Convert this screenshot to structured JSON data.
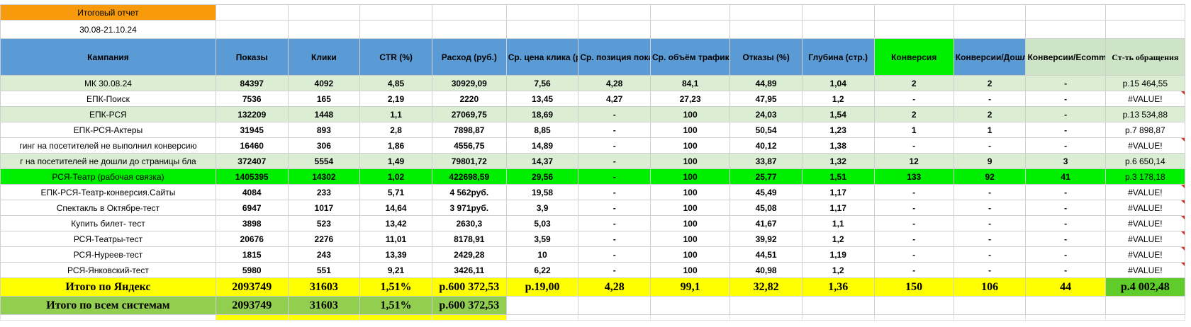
{
  "report_title": "Итоговый отчет",
  "period": "30.08-21.10.24",
  "headers": {
    "campaign": "Кампания",
    "impressions": "Показы",
    "clicks": "Клики",
    "ctr": "CTR (%)",
    "spend": "Расход (руб.)",
    "avg_cpc": "Ср. цена клика (руб.)",
    "avg_position": "Ср. позиция показов",
    "avg_traffic": "Ср. объём трафика",
    "bounce": "Отказы (%)",
    "depth": "Глубина (стр.)",
    "conversion": "Конверсия",
    "conv_thanks": "Конверсии/Дошли до страницы благодарности",
    "conv_ecom": "Конверсии/Ecommerce: покупка",
    "cost_per_conv": "Ст-ть обращения"
  },
  "rows": [
    {
      "campaign": "МК 30.08.24",
      "impressions": "84397",
      "clicks": "4092",
      "ctr": "4,85",
      "spend": "30929,09",
      "cpc": "7,56",
      "position": "4,28",
      "traffic": "84,1",
      "bounce": "44,89",
      "depth": "1,04",
      "conversion": "2",
      "conv_thanks": "2",
      "conv_ecom": "-",
      "cost": "р.15 464,55",
      "style": "light",
      "error": false
    },
    {
      "campaign": "ЕПК-Поиск",
      "impressions": "7536",
      "clicks": "165",
      "ctr": "2,19",
      "spend": "2220",
      "cpc": "13,45",
      "position": "4,27",
      "traffic": "27,23",
      "bounce": "47,95",
      "depth": "1,2",
      "conversion": "-",
      "conv_thanks": "-",
      "conv_ecom": "-",
      "cost": "#VALUE!",
      "style": "plain",
      "error": true
    },
    {
      "campaign": "ЕПК-РСЯ",
      "impressions": "132209",
      "clicks": "1448",
      "ctr": "1,1",
      "spend": "27069,75",
      "cpc": "18,69",
      "position": "-",
      "traffic": "100",
      "bounce": "24,03",
      "depth": "1,54",
      "conversion": "2",
      "conv_thanks": "2",
      "conv_ecom": "-",
      "cost": "р.13 534,88",
      "style": "light",
      "error": false
    },
    {
      "campaign": "ЕПК-РСЯ-Актеры",
      "impressions": "31945",
      "clicks": "893",
      "ctr": "2,8",
      "spend": "7898,87",
      "cpc": "8,85",
      "position": "-",
      "traffic": "100",
      "bounce": "50,54",
      "depth": "1,23",
      "conversion": "1",
      "conv_thanks": "1",
      "conv_ecom": "-",
      "cost": "р.7 898,87",
      "style": "plain",
      "error": false
    },
    {
      "campaign": "гинг на посетителей не выполнил конверсию",
      "impressions": "16460",
      "clicks": "306",
      "ctr": "1,86",
      "spend": "4556,75",
      "cpc": "14,89",
      "position": "-",
      "traffic": "100",
      "bounce": "40,12",
      "depth": "1,38",
      "conversion": "-",
      "conv_thanks": "-",
      "conv_ecom": "-",
      "cost": "#VALUE!",
      "style": "plain",
      "error": true,
      "left": true
    },
    {
      "campaign": "г на посетителей не дошли до страницы бла",
      "impressions": "372407",
      "clicks": "5554",
      "ctr": "1,49",
      "spend": "79801,72",
      "cpc": "14,37",
      "position": "-",
      "traffic": "100",
      "bounce": "33,87",
      "depth": "1,32",
      "conversion": "12",
      "conv_thanks": "9",
      "conv_ecom": "3",
      "cost": "р.6 650,14",
      "style": "light",
      "error": false,
      "left": true
    },
    {
      "campaign": "РСЯ-Театр (рабочая связка)",
      "impressions": "1405395",
      "clicks": "14302",
      "ctr": "1,02",
      "spend": "422698,59",
      "cpc": "29,56",
      "position": "-",
      "traffic": "100",
      "bounce": "25,77",
      "depth": "1,51",
      "conversion": "133",
      "conv_thanks": "92",
      "conv_ecom": "41",
      "cost": "р.3 178,18",
      "style": "bright",
      "error": false
    },
    {
      "campaign": "ЕПК-РСЯ-Театр-конверсия.Сайты",
      "impressions": "4084",
      "clicks": "233",
      "ctr": "5,71",
      "spend": "4 562руб.",
      "cpc": "19,58",
      "position": "-",
      "traffic": "100",
      "bounce": "45,49",
      "depth": "1,17",
      "conversion": "-",
      "conv_thanks": "-",
      "conv_ecom": "-",
      "cost": "#VALUE!",
      "style": "plain",
      "error": true
    },
    {
      "campaign": "Спектакль в Октябре-тест",
      "impressions": "6947",
      "clicks": "1017",
      "ctr": "14,64",
      "spend": "3 971руб.",
      "cpc": "3,9",
      "position": "-",
      "traffic": "100",
      "bounce": "45,08",
      "depth": "1,17",
      "conversion": "-",
      "conv_thanks": "-",
      "conv_ecom": "-",
      "cost": "#VALUE!",
      "style": "plain",
      "error": true
    },
    {
      "campaign": "Купить билет- тест",
      "impressions": "3898",
      "clicks": "523",
      "ctr": "13,42",
      "spend": "2630,3",
      "cpc": "5,03",
      "position": "-",
      "traffic": "100",
      "bounce": "41,67",
      "depth": "1,1",
      "conversion": "-",
      "conv_thanks": "-",
      "conv_ecom": "-",
      "cost": "#VALUE!",
      "style": "plain",
      "error": true
    },
    {
      "campaign": "РСЯ-Театры-тест",
      "impressions": "20676",
      "clicks": "2276",
      "ctr": "11,01",
      "spend": "8178,91",
      "cpc": "3,59",
      "position": "-",
      "traffic": "100",
      "bounce": "39,92",
      "depth": "1,2",
      "conversion": "-",
      "conv_thanks": "-",
      "conv_ecom": "-",
      "cost": "#VALUE!",
      "style": "plain",
      "error": true
    },
    {
      "campaign": "РСЯ-Нуреев-тест",
      "impressions": "1815",
      "clicks": "243",
      "ctr": "13,39",
      "spend": "2429,28",
      "cpc": "10",
      "position": "-",
      "traffic": "100",
      "bounce": "44,51",
      "depth": "1,19",
      "conversion": "-",
      "conv_thanks": "-",
      "conv_ecom": "-",
      "cost": "#VALUE!",
      "style": "plain",
      "error": true
    },
    {
      "campaign": "РСЯ-Янковский-тест",
      "impressions": "5980",
      "clicks": "551",
      "ctr": "9,21",
      "spend": "3426,11",
      "cpc": "6,22",
      "position": "-",
      "traffic": "100",
      "bounce": "40,98",
      "depth": "1,2",
      "conversion": "-",
      "conv_thanks": "-",
      "conv_ecom": "-",
      "cost": "#VALUE!",
      "style": "plain",
      "error": true
    }
  ],
  "total_yandex": {
    "label": "Итого по Яндекс",
    "impressions": "2093749",
    "clicks": "31603",
    "ctr": "1,51%",
    "spend": "р.600 372,53",
    "cpc": "р.19,00",
    "position": "4,28",
    "traffic": "99,1",
    "bounce": "32,82",
    "depth": "1,36",
    "conversion": "150",
    "conv_thanks": "106",
    "conv_ecom": "44",
    "cost": "р.4 002,48"
  },
  "total_all": {
    "label": "Итого по всем системам",
    "impressions": "2093749",
    "clicks": "31603",
    "ctr": "1,51%",
    "spend": "р.600 372,53"
  },
  "colors": {
    "title_orange": "#f79a0c",
    "header_blue": "#5b9bd5",
    "conversion_green": "#00ee00",
    "row_light_green": "#dbeed4",
    "total_yellow": "#ffff00",
    "total_all_green": "#92cf51"
  }
}
